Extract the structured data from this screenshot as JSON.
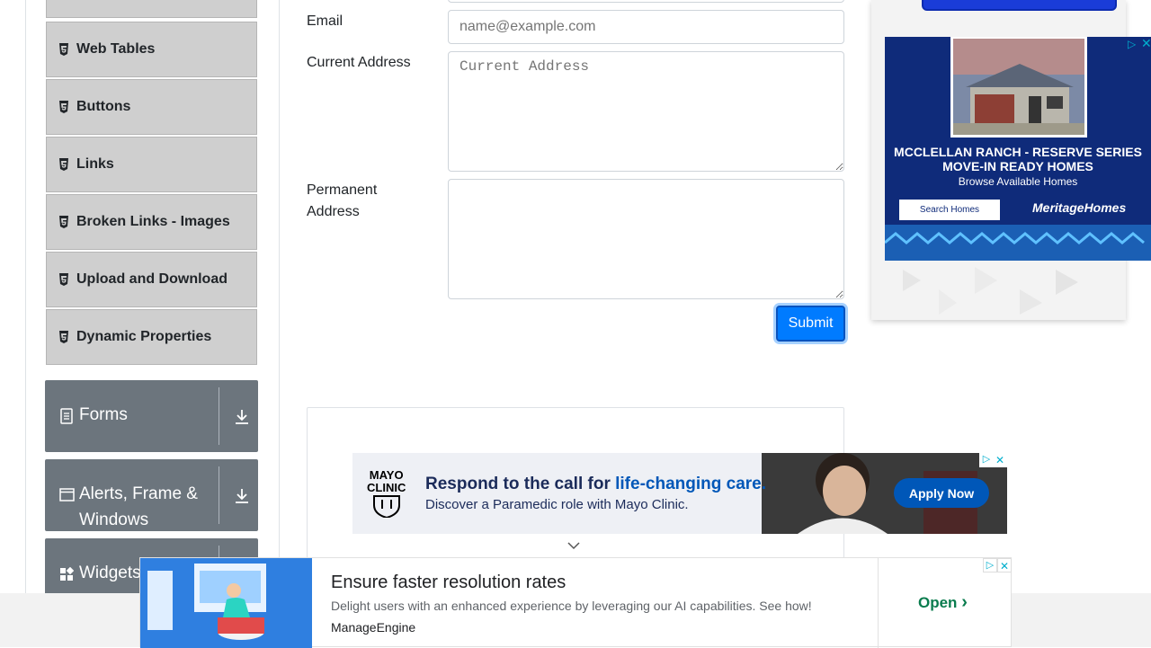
{
  "sidebar": {
    "items": [
      {
        "label": "Web Tables"
      },
      {
        "label": "Buttons"
      },
      {
        "label": "Links"
      },
      {
        "label": "Broken Links - Images"
      },
      {
        "label": "Upload and Download"
      },
      {
        "label": "Dynamic Properties"
      }
    ],
    "groups": [
      {
        "label": "Forms"
      },
      {
        "label": "Alerts, Frame & Windows"
      },
      {
        "label": "Widgets"
      }
    ]
  },
  "form": {
    "email_label": "Email",
    "email_placeholder": "name@example.com",
    "current_label": "Current Address",
    "current_placeholder": "Current Address",
    "permanent_label": "Permanent Address",
    "submit_label": "Submit"
  },
  "ads": {
    "house": {
      "headline1": "MCCLELLAN RANCH - RESERVE SERIES",
      "headline2": "MOVE-IN READY HOMES",
      "sub": "Browse Available Homes",
      "button": "Search Homes",
      "brand": "MeritageHomes"
    },
    "mayo": {
      "logo_line1": "MAYO",
      "logo_line2": "CLINIC",
      "headline_a": "Respond to the call for ",
      "headline_b": "life-changing care.",
      "sub": "Discover a Paramedic role with Mayo Clinic.",
      "cta": "Apply Now"
    },
    "bottom": {
      "title": "Ensure faster resolution rates",
      "desc": "Delight users with an enhanced experience by leveraging our AI capabilities. See how!",
      "brand": "ManageEngine",
      "cta": "Open"
    }
  },
  "colors": {
    "primary": "#007bff",
    "group_bg": "#6c757d",
    "menu_bg": "#cfcfcf",
    "adchoice": "#00aecd",
    "mayo_blue": "#0057b8",
    "house_navy": "#0f2b7a"
  }
}
